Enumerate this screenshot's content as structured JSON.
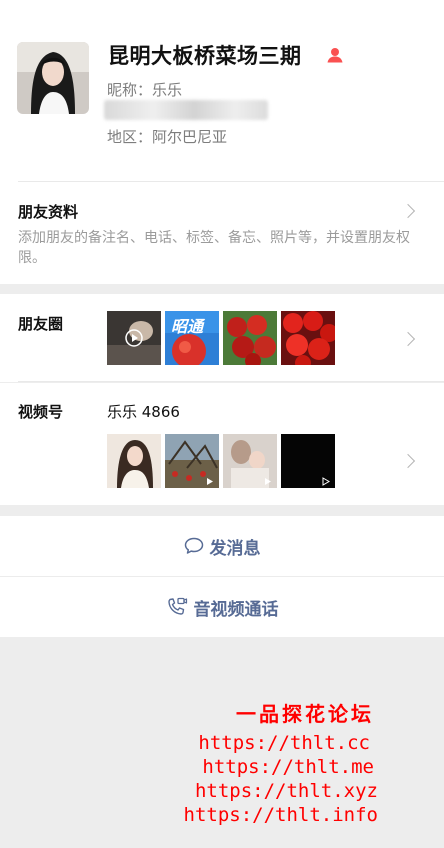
{
  "profile": {
    "name": "昆明大板桥菜场三期",
    "nickname": "昵称：乐乐",
    "region": "地区：阿尔巴尼亚",
    "gender_icon": "female-user-icon",
    "gender_color": "#fa5151"
  },
  "friend_info": {
    "title": "朋友资料",
    "description": "添加朋友的备注名、电话、标签、备忘、照片等，并设置朋友权限。"
  },
  "moments": {
    "label": "朋友圈",
    "thumbnail_text": "昭通"
  },
  "channels": {
    "label": "视频号",
    "name": "乐乐 4866"
  },
  "actions": {
    "message": "发消息",
    "call": "音视频通话",
    "link_color": "#576b95"
  },
  "watermark": {
    "title": "一品探花论坛",
    "urls": [
      "https://thlt.cc",
      "https://thlt.me",
      "https://thlt.xyz",
      "https://thlt.info"
    ],
    "color": "#ff0000"
  }
}
